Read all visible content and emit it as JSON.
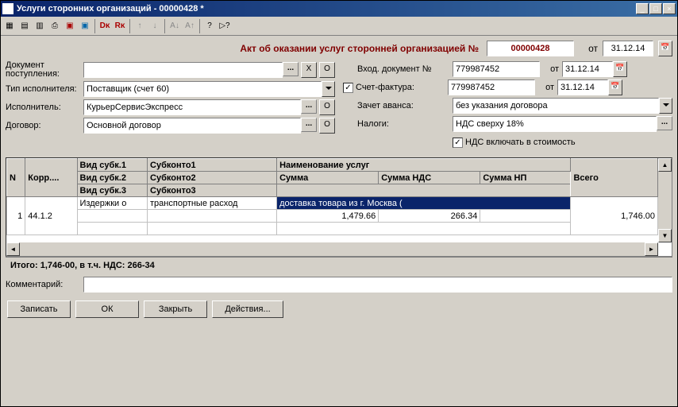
{
  "window": {
    "title": "Услуги сторонних организаций - 00000428 *"
  },
  "toolbar_icons": [
    "form-icon",
    "report-icon",
    "tree-icon",
    "print-icon",
    "doc1-icon",
    "doc2-icon",
    "sep",
    "doc-action-icon",
    "check-red-icon",
    "sep",
    "up-icon",
    "down-icon",
    "sep",
    "sort-asc-icon",
    "sort-desc-icon",
    "sep",
    "help-icon",
    "what-icon"
  ],
  "heading": {
    "text": "Акт об оказании услуг сторонней организацией №",
    "doc_number": "00000428",
    "from_label": "от",
    "date": "31.12.14"
  },
  "left": {
    "doc_income_label": "Документ поступления:",
    "doc_income_value": "",
    "x_btn": "X",
    "o_btn": "О",
    "type_label": "Тип исполнителя:",
    "type_value": "Поставщик (счет 60)",
    "executor_label": "Исполнитель:",
    "executor_value": "КурьерСервисЭкспресс",
    "contract_label": "Договор:",
    "contract_value": "Основной договор"
  },
  "right": {
    "in_doc_label": "Вход. документ №",
    "in_doc_value": "779987452",
    "in_doc_from": "от",
    "in_doc_date": "31.12.14",
    "invoice_label": "Счет-фактура:",
    "invoice_value": "779987452",
    "invoice_from": "от",
    "invoice_date": "31.12.14",
    "advance_label": "Зачет аванса:",
    "advance_value": "без указания договора",
    "taxes_label": "Налоги:",
    "taxes_value": "НДС сверху 18%",
    "nds_include_label": "НДС включать в стоимость"
  },
  "grid": {
    "headers": {
      "n": "N",
      "korr": "Корр....",
      "vid1": "Вид субк.1",
      "sub1": "Субконто1",
      "vid2": "Вид субк.2",
      "sub2": "Субконто2",
      "vid3": "Вид субк.3",
      "sub3": "Субконто3",
      "name": "Наименование услуг",
      "sum": "Сумма",
      "sum_nds": "Сумма НДС",
      "sum_np": "Сумма НП",
      "total": "Всего"
    },
    "rows": [
      {
        "n": "1",
        "korr": "44.1.2",
        "vid1": "Издержки о",
        "sub1": "транспортные расход",
        "name": "доставка товара из г. Москва (",
        "sum": "1,479.66",
        "sum_nds": "266.34",
        "sum_np": "",
        "total": "1,746.00"
      }
    ]
  },
  "totals": "Итого: 1,746-00, в т.ч. НДС: 266-34",
  "comment_label": "Комментарий:",
  "comment_value": "",
  "buttons": {
    "write": "Записать",
    "ok": "ОК",
    "close": "Закрыть",
    "actions": "Действия..."
  }
}
